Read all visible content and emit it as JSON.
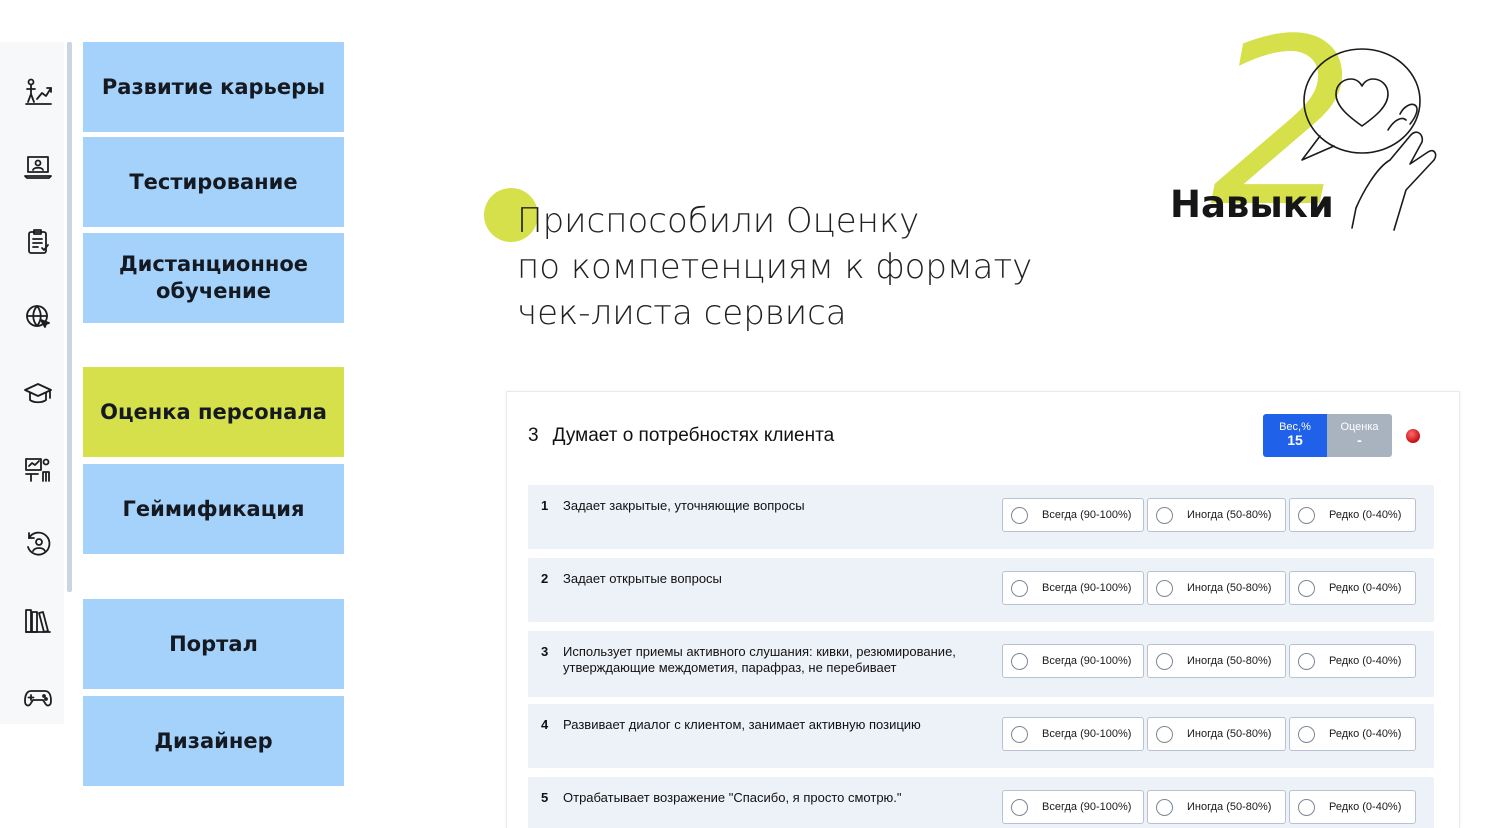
{
  "sidebar": {
    "icons": [
      "career-growth-icon",
      "laptop-icon",
      "clipboard-icon",
      "globe-cursor-icon",
      "graduation-cap-icon",
      "presentation-icon",
      "person-refresh-icon",
      "bookshelf-icon",
      "gamepad-icon"
    ]
  },
  "menu": {
    "items": [
      {
        "label": "Развитие карьеры"
      },
      {
        "label": "Тестирование"
      },
      {
        "label": "Дистанционное обучение"
      },
      {
        "label": "Оценка персонала"
      },
      {
        "label": "Геймификация"
      },
      {
        "label": "Портал"
      },
      {
        "label": "Дизайнер"
      }
    ],
    "active": "Оценка персонала"
  },
  "headline": {
    "line1": "Приспособили Оценку",
    "line2": "по компетенциям к формату",
    "line3": "чек-листа сервиса"
  },
  "badge": {
    "number": "2",
    "label": "Навыки"
  },
  "checklist": {
    "section_number": "3",
    "section_title": "Думает о потребностях клиента",
    "weight_label": "Вес,%",
    "weight_value": "15",
    "score_label": "Оценка",
    "score_value": "-",
    "status_color": "#d0161a",
    "options": [
      "Всегда (90-100%)",
      "Иногда (50-80%)",
      "Редко (0-40%)"
    ],
    "rows": [
      {
        "num": "1",
        "text": "Задает закрытые, уточняющие вопросы"
      },
      {
        "num": "2",
        "text": "Задает открытые вопросы"
      },
      {
        "num": "3",
        "text": "Использует приемы активного слушания: кивки, резюмирование, утверждающие междометия, парафраз, не перебивает"
      },
      {
        "num": "4",
        "text": "Развивает диалог с клиентом, занимает активную позицию"
      },
      {
        "num": "5",
        "text": "Отрабатывает возражение \"Спасибо, я просто смотрю.\""
      }
    ]
  },
  "colors": {
    "tile": "#a5d2fb",
    "tile_active": "#d6e04a",
    "accent_blue": "#1f61e8",
    "accent_yellow": "#d6e04a"
  }
}
